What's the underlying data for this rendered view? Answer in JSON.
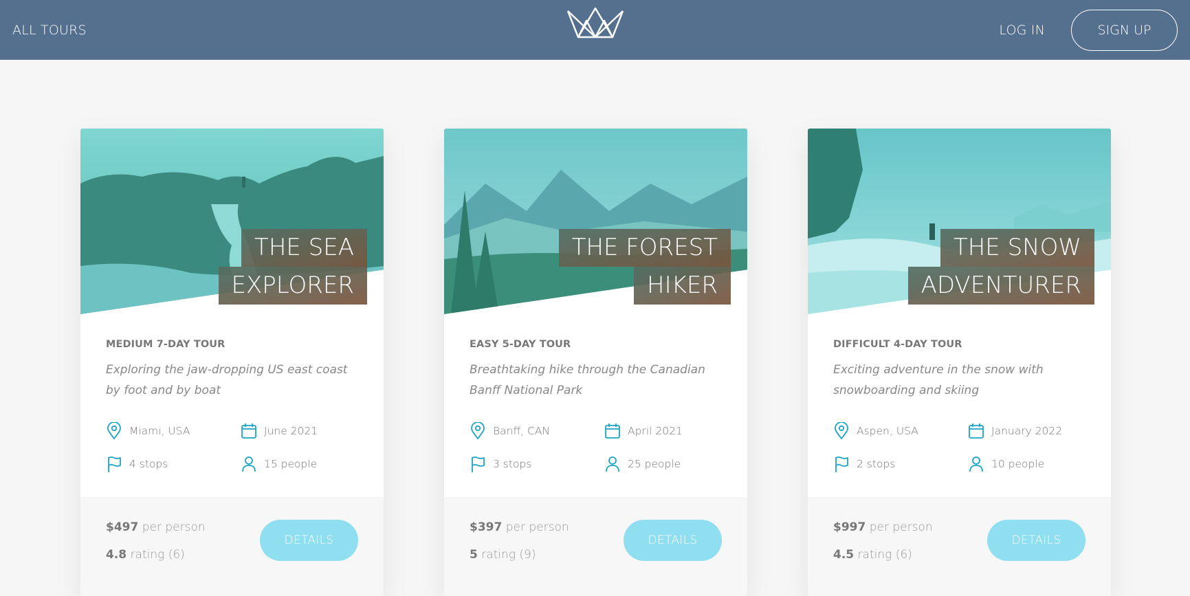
{
  "header": {
    "all_tours": "ALL TOURS",
    "login": "LOG IN",
    "signup": "SIGN UP",
    "logo_icon": "crown-icon"
  },
  "colors": {
    "header_bg": "#55708f",
    "accent": "#1aa5c6",
    "details_button": "#8fdff0"
  },
  "cards": [
    {
      "title_line1": "THE SEA",
      "title_line2": "EXPLORER",
      "difficulty": "MEDIUM 7-DAY TOUR",
      "summary": "Exploring the jaw-dropping US east coast by foot and by boat",
      "location": "Miami, USA",
      "date": "June 2021",
      "stops": "4 stops",
      "people": "15 people",
      "price": "$497",
      "price_suffix": "per person",
      "rating": "4.8",
      "rating_suffix": "rating (6)",
      "button": "DETAILS"
    },
    {
      "title_line1": "THE FOREST",
      "title_line2": "HIKER",
      "difficulty": "EASY 5-DAY TOUR",
      "summary": "Breathtaking hike through the Canadian Banff National Park",
      "location": "Banff, CAN",
      "date": "April 2021",
      "stops": "3 stops",
      "people": "25 people",
      "price": "$397",
      "price_suffix": "per person",
      "rating": "5",
      "rating_suffix": "rating (9)",
      "button": "DETAILS"
    },
    {
      "title_line1": "THE SNOW",
      "title_line2": "ADVENTURER",
      "difficulty": "DIFFICULT 4-DAY TOUR",
      "summary": "Exciting adventure in the snow with snowboarding and skiing",
      "location": "Aspen, USA",
      "date": "January 2022",
      "stops": "2 stops",
      "people": "10 people",
      "price": "$997",
      "price_suffix": "per person",
      "rating": "4.5",
      "rating_suffix": "rating (6)",
      "button": "DETAILS"
    }
  ]
}
